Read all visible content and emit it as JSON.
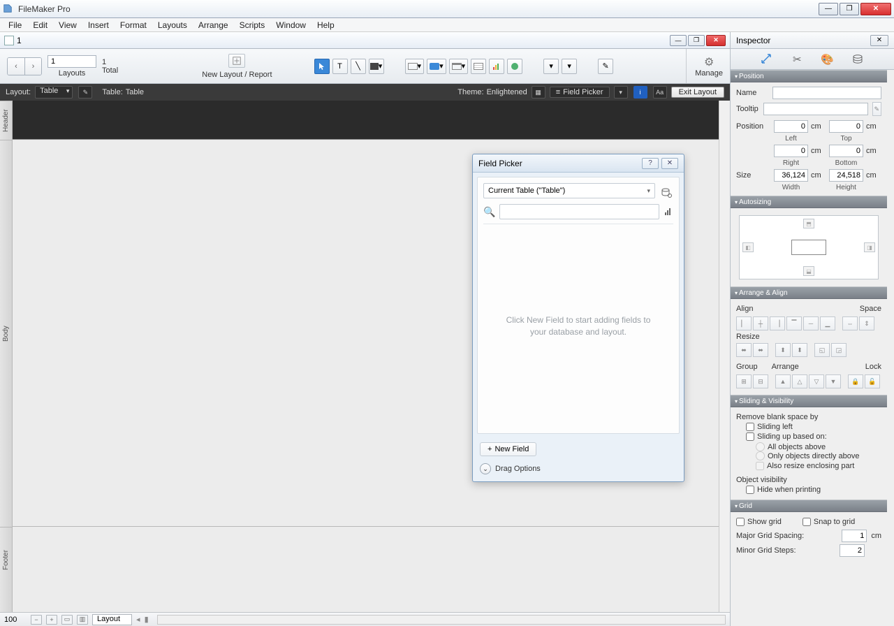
{
  "app": {
    "title": "FileMaker Pro"
  },
  "menus": [
    "File",
    "Edit",
    "View",
    "Insert",
    "Format",
    "Layouts",
    "Arrange",
    "Scripts",
    "Window",
    "Help"
  ],
  "doc": {
    "title": "1"
  },
  "toolbar": {
    "layout_number": "1",
    "layouts_label": "Layouts",
    "total_count": "1",
    "total_label": "Total",
    "new_layout_label": "New Layout / Report",
    "manage_label": "Manage"
  },
  "layoutbar": {
    "layout_label": "Layout:",
    "layout_value": "Table",
    "table_label": "Table:",
    "table_value": "Table",
    "theme_label": "Theme:",
    "theme_value": "Enlightened",
    "field_picker": "Field Picker",
    "exit_layout": "Exit Layout"
  },
  "parts": {
    "header": "Header",
    "body": "Body",
    "footer": "Footer"
  },
  "statusbar": {
    "zoom": "100",
    "mode": "Layout"
  },
  "inspector": {
    "title": "Inspector",
    "sections": {
      "position": "Position",
      "autosizing": "Autosizing",
      "arrange": "Arrange & Align",
      "sliding": "Sliding & Visibility",
      "grid": "Grid"
    },
    "position": {
      "name_lbl": "Name",
      "name_val": "",
      "tooltip_lbl": "Tooltip",
      "tooltip_val": "",
      "position_lbl": "Position",
      "left_val": "0",
      "left_lbl": "Left",
      "top_val": "0",
      "top_lbl": "Top",
      "right_val": "0",
      "right_lbl": "Right",
      "bottom_val": "0",
      "bottom_lbl": "Bottom",
      "size_lbl": "Size",
      "width_val": "36,124",
      "width_lbl": "Width",
      "height_val": "24,518",
      "height_lbl": "Height",
      "unit": "cm"
    },
    "arrange": {
      "align_lbl": "Align",
      "space_lbl": "Space",
      "resize_lbl": "Resize",
      "group_lbl": "Group",
      "arrange_lbl": "Arrange",
      "lock_lbl": "Lock"
    },
    "sliding": {
      "remove_lbl": "Remove blank space by",
      "sliding_left": "Sliding left",
      "sliding_up": "Sliding up based on:",
      "all_above": "All objects above",
      "only_above": "Only objects directly above",
      "also_resize": "Also resize enclosing part",
      "visibility_lbl": "Object visibility",
      "hide_printing": "Hide when printing"
    },
    "grid": {
      "show_grid": "Show grid",
      "snap_grid": "Snap to grid",
      "major_lbl": "Major Grid Spacing:",
      "major_val": "1",
      "major_unit": "cm",
      "minor_lbl": "Minor Grid Steps:",
      "minor_val": "2"
    }
  },
  "field_picker": {
    "title": "Field Picker",
    "table_combo": "Current Table (\"Table\")",
    "empty_msg": "Click New Field to start adding fields to your database and layout.",
    "new_field": "New Field",
    "drag_options": "Drag Options"
  }
}
